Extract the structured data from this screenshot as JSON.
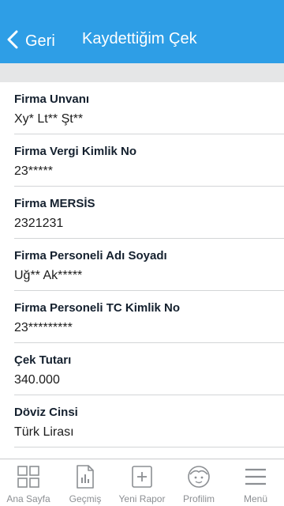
{
  "header": {
    "back_label": "Geri",
    "title": "Kaydettiğim Çek",
    "background_color": "#2e9ee6"
  },
  "fields": [
    {
      "label": "Firma Unvanı",
      "value": "Xy* Lt** Şt**"
    },
    {
      "label": "Firma Vergi Kimlik No",
      "value": "23*****"
    },
    {
      "label": "Firma MERSİS",
      "value": "2321231"
    },
    {
      "label": "Firma Personeli Adı Soyadı",
      "value": "Uğ** Ak*****"
    },
    {
      "label": "Firma Personeli TC Kimlik No",
      "value": "23*********"
    },
    {
      "label": "Çek Tutarı",
      "value": "340.000"
    },
    {
      "label": "Döviz Cinsi",
      "value": "Türk Lirası"
    }
  ],
  "tabbar": {
    "items": [
      {
        "label": "Ana Sayfa",
        "icon": "grid-icon"
      },
      {
        "label": "Geçmiş",
        "icon": "document-chart-icon"
      },
      {
        "label": "Yeni Rapor",
        "icon": "plus-box-icon"
      },
      {
        "label": "Profilim",
        "icon": "face-icon"
      },
      {
        "label": "Menü",
        "icon": "hamburger-icon"
      }
    ]
  }
}
